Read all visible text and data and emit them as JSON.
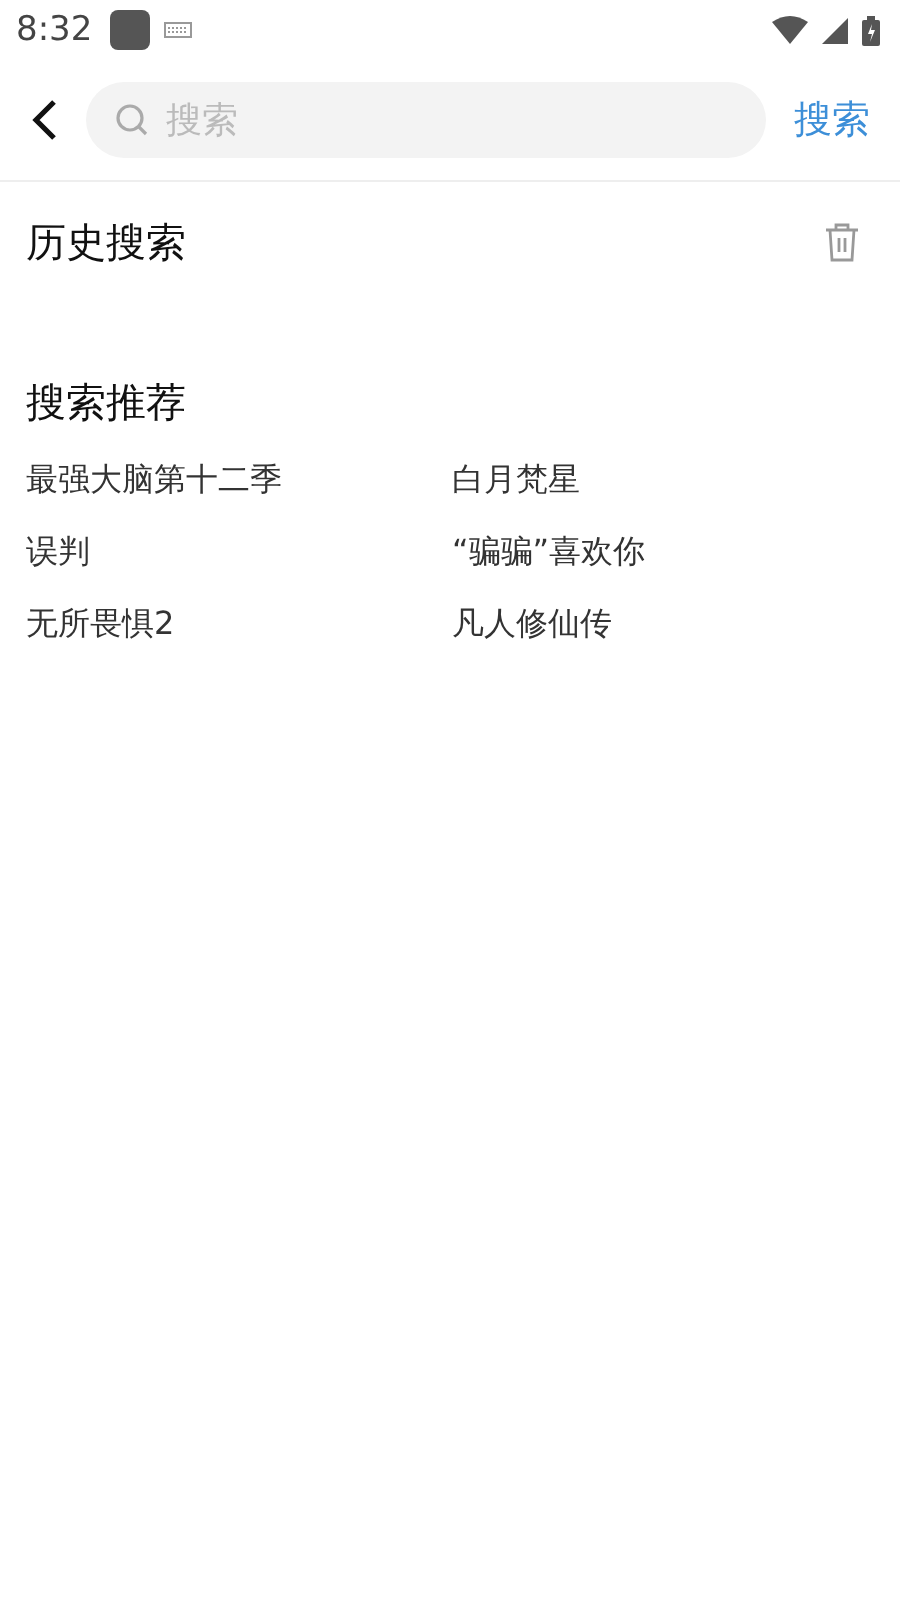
{
  "status_bar": {
    "time": "8:32"
  },
  "search": {
    "placeholder": "搜索",
    "button": "搜索"
  },
  "history": {
    "title": "历史搜索"
  },
  "recommend": {
    "title": "搜索推荐",
    "items": [
      {
        "label": "最强大脑第十二季"
      },
      {
        "label": "白月梵星"
      },
      {
        "label": "误判"
      },
      {
        "label": "“骗骗”喜欢你"
      },
      {
        "label": "无所畏惧2"
      },
      {
        "label": "凡人修仙传"
      }
    ]
  }
}
